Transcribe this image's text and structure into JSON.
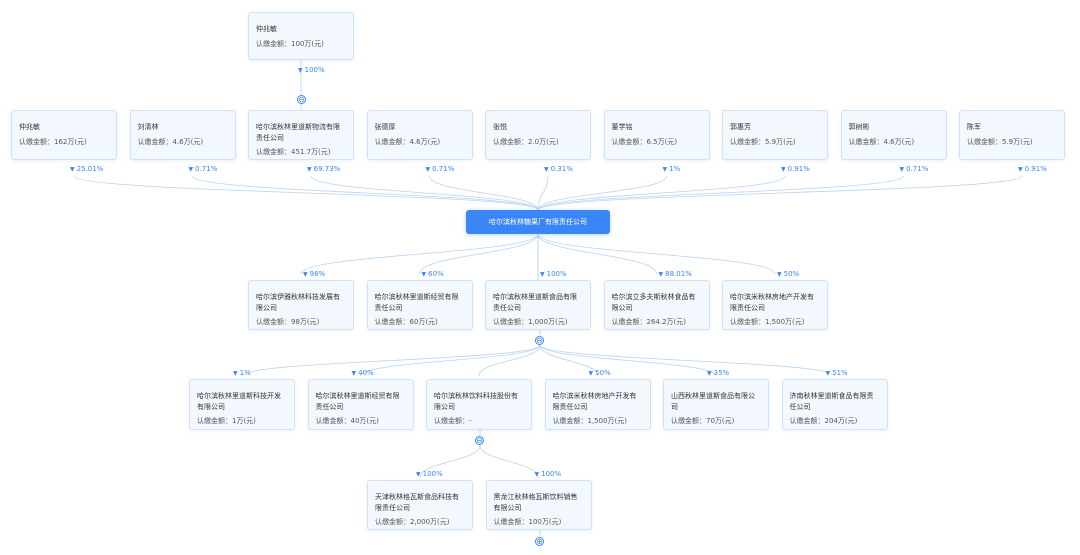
{
  "center": {
    "name": "哈尔滨秋林糖果厂有限责任公司"
  },
  "top_shareholder": {
    "name": "仲兆敏",
    "amount": "认缴金额：100万(元)",
    "percent": "100%"
  },
  "shareholders": [
    {
      "name": "仲兆敏",
      "amount": "认缴金额：162万(元)",
      "percent": "25.01%"
    },
    {
      "name": "刘清林",
      "amount": "认缴金额：4.6万(元)",
      "percent": "0.71%"
    },
    {
      "name": "哈尔滨秋林里道斯物流有限责任公司",
      "amount": "认缴金额：451.7万(元)",
      "percent": "69.73%"
    },
    {
      "name": "张德厚",
      "amount": "认缴金额：4.6万(元)",
      "percent": "0.71%"
    },
    {
      "name": "张悦",
      "amount": "认缴金额：2.0万(元)",
      "percent": "0.31%"
    },
    {
      "name": "董学铭",
      "amount": "认缴金额：6.5万(元)",
      "percent": "1%"
    },
    {
      "name": "郭惠芳",
      "amount": "认缴金额：5.9万(元)",
      "percent": "0.91%"
    },
    {
      "name": "郭树彬",
      "amount": "认缴金额：4.6万(元)",
      "percent": "0.71%"
    },
    {
      "name": "陈军",
      "amount": "认缴金额：5.9万(元)",
      "percent": "0.91%"
    }
  ],
  "investments": [
    {
      "name": "哈尔滨伊雅秋林科技发展有限公司",
      "amount": "认缴金额：98万(元)",
      "percent": "98%"
    },
    {
      "name": "哈尔滨秋林里道斯经贸有限责任公司",
      "amount": "认缴金额：60万(元)",
      "percent": "60%"
    },
    {
      "name": "哈尔滨秋林里道斯食品有限责任公司",
      "amount": "认缴金额：1,000万(元)",
      "percent": "100%"
    },
    {
      "name": "哈尔滨立多夫斯秋林食品有限公司",
      "amount": "认缴金额：264.2万(元)",
      "percent": "88.01%"
    },
    {
      "name": "哈尔滨米秋林房地产开发有限责任公司",
      "amount": "认缴金额：1,500万(元)",
      "percent": "50%"
    }
  ],
  "sub_investments": [
    {
      "name": "哈尔滨秋林里道斯科技开发有限公司",
      "amount": "认缴金额：1万(元)",
      "percent": "1%"
    },
    {
      "name": "哈尔滨秋林里道斯经贸有限责任公司",
      "amount": "认缴金额：40万(元)",
      "percent": "40%"
    },
    {
      "name": "哈尔滨秋林饮料科技股份有限公司",
      "amount": "认缴金额：-",
      "percent": ""
    },
    {
      "name": "哈尔滨米秋林房地产开发有限责任公司",
      "amount": "认缴金额：1,500万(元)",
      "percent": "50%"
    },
    {
      "name": "山西秋林里道斯食品有限公司",
      "amount": "认缴金额：70万(元)",
      "percent": "35%"
    },
    {
      "name": "济南秋林里道斯食品有限责任公司",
      "amount": "认缴金额：204万(元)",
      "percent": "51%"
    }
  ],
  "sub_sub_investments": [
    {
      "name": "天津秋林格瓦斯食品科技有限责任公司",
      "amount": "认缴金额：2,000万(元)",
      "percent": "100%"
    },
    {
      "name": "黑龙江秋林格瓦斯饮料销售有限公司",
      "amount": "认缴金额：100万(元)",
      "percent": "100%"
    }
  ],
  "toggle_icons": {
    "collapse": "⊖",
    "expand": "⊕"
  },
  "colors": {
    "accent": "#3a86f7",
    "card_bg": "#f2f8fe",
    "card_border": "#cfe2f6",
    "line": "#b9d3f2"
  }
}
